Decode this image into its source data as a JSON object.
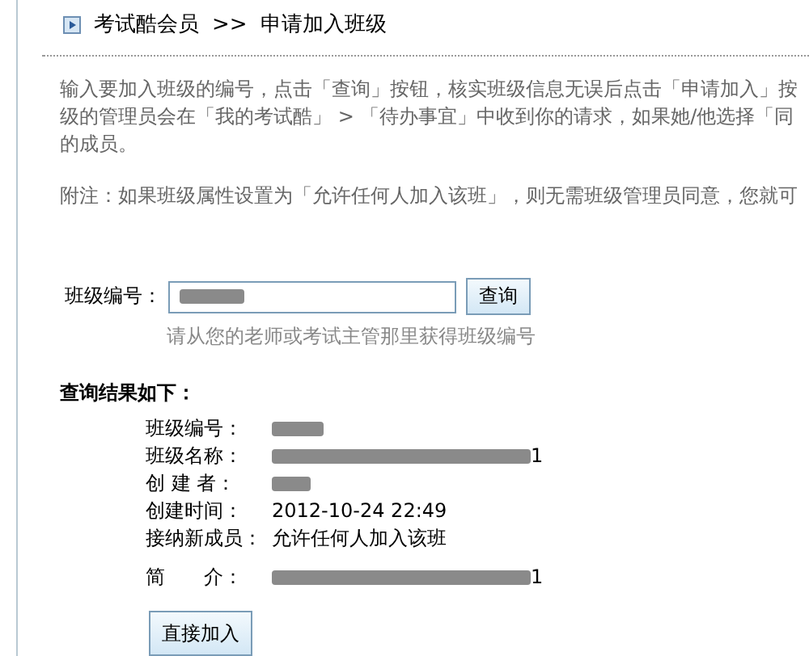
{
  "breadcrumb": {
    "section": "考试酷会员",
    "separator": ">>",
    "page": "申请加入班级"
  },
  "intro_lines": [
    "输入要加入班级的编号，点击「查询」按钮，核实班级信息无误后点击「申请加入」按",
    "级的管理员会在「我的考试酷」 > 「待办事宜」中收到你的请求，如果她/他选择「同",
    "的成员。"
  ],
  "note": "附注：如果班级属性设置为「允许任何人加入该班」，则无需班级管理员同意，您就可",
  "search": {
    "label": "班级编号：",
    "value_redacted": true,
    "button": "查询",
    "hint": "请从您的老师或考试主管那里获得班级编号"
  },
  "results": {
    "title": "查询结果如下：",
    "rows": [
      {
        "label": "班级编号：",
        "redacted": true
      },
      {
        "label": "班级名称：",
        "value": "1",
        "redacted": true
      },
      {
        "label": "创 建 者：",
        "redacted": true
      },
      {
        "label": "创建时间：",
        "value": "2012-10-24 22:49"
      },
      {
        "label": "接纳新成员：",
        "value": "允许任何人加入该班"
      },
      {
        "label": "简　　介：",
        "value": "1",
        "redacted": true
      }
    ]
  },
  "join_button": "直接加入"
}
